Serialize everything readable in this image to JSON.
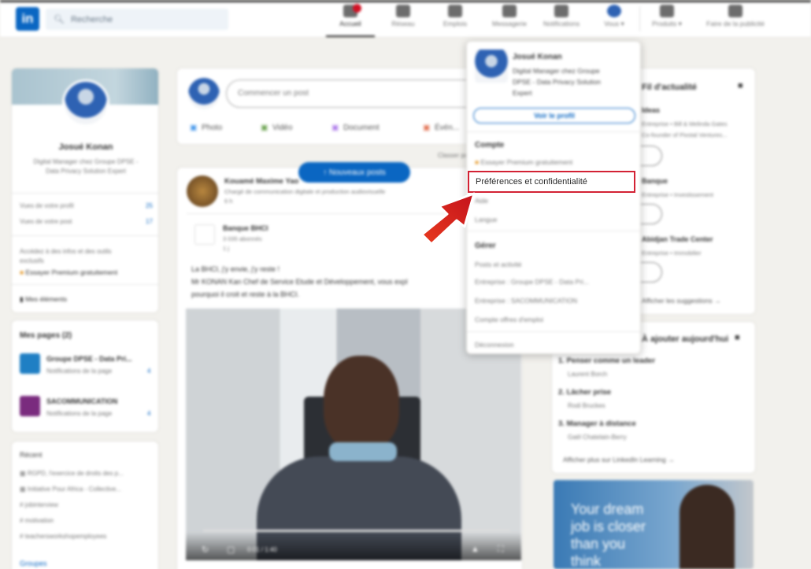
{
  "nav": {
    "logo": "in",
    "search_placeholder": "Recherche",
    "items": [
      {
        "label": "Accueil"
      },
      {
        "label": "Réseau"
      },
      {
        "label": "Emplois"
      },
      {
        "label": "Messagerie"
      },
      {
        "label": "Notifications"
      },
      {
        "label": "Vous ▾"
      },
      {
        "label": "Produits ▾"
      },
      {
        "label": "Faire de la publicité"
      }
    ]
  },
  "profile": {
    "name": "Josué Konan",
    "headline_1": "Digital Manager chez Groupe DPSE -",
    "headline_2": "Data Privacy Solution Expert",
    "stat_1": "Vues de votre profil",
    "stat_1_val": "25",
    "stat_2": "Vues de votre post",
    "stat_2_val": "17",
    "premium_1": "Accédez à des infos et des outils",
    "premium_2": "exclusifs",
    "premium_3": "Essayer Premium gratuitement",
    "saved": "Mes éléments"
  },
  "pages": {
    "title": "Mes pages (2)",
    "items": [
      {
        "name": "Groupe DPSE - Data Pri...",
        "sub": "Notifications de la page",
        "count": "4"
      },
      {
        "name": "SACOMMUNICATION",
        "sub": "Notifications de la page",
        "count": "4"
      }
    ]
  },
  "recent": {
    "title": "Récent",
    "items": [
      "RGPD, l'exercice de droits des p...",
      "Initiative Pour Africa - Collective...",
      "jobinterview",
      "motivation",
      "teachersworkshopemployees"
    ],
    "groups": "Groupes"
  },
  "composer": {
    "placeholder": "Commencer un post",
    "photo": "Photo",
    "video": "Vidéo",
    "document": "Document",
    "event": "Évén..."
  },
  "new_posts": "↑ Nouveaux posts",
  "sort_label": "Classer par",
  "post": {
    "author": "Kouamé Maxime Yao",
    "author_sub": "Chargé de communication digitale et production audiovisuelle",
    "time": "6 h",
    "shared_author": "Banque BHCI",
    "shared_sub": "3 035 abonnés",
    "shared_time": "1 j",
    "text_1": "La BHCI, j'y envie, j'y reste !",
    "text_2": "Mr KONAN Kan Chef de Service Etude et Développement, vous expl",
    "text_3": "pourquoi il croit et reste à la BHCI.",
    "video_time": "0:01 / 1:40"
  },
  "menu": {
    "name": "Josué Konan",
    "headline_1": "Digital Manager chez Groupe",
    "headline_2": "DPSE - Data Privacy Solution",
    "headline_3": "Expert",
    "view_profile": "Voir le profil",
    "account_title": "Compte",
    "premium": "Essayer Premium gratuitement",
    "preferences": "Préférences et confidentialité",
    "help": "Aide",
    "language": "Langue",
    "manage_title": "Gérer",
    "posts": "Posts et activité",
    "company_1": "Entreprise : Groupe DPSE - Data Pri...",
    "company_2": "Entreprise : SACOMMUNICATION",
    "jobs": "Compte offres d'emploi",
    "logout": "Déconnexion"
  },
  "news": {
    "title": "Fil d'actualité",
    "items": [
      {
        "name": "Ideas",
        "sub": "Entreprise • Bill & Melinda Gates",
        "sub2": "Co-founder of Pivotal Ventures..."
      },
      {
        "name": "Banque",
        "sub": "Entreprise • Investissement"
      },
      {
        "name": "Abidjan Trade Center",
        "sub": "Entreprise • Immobilier"
      }
    ],
    "more": "Afficher les suggestions →"
  },
  "learning": {
    "title": "À ajouter aujourd'hui",
    "items": [
      {
        "rank": "1.",
        "name": "Penser comme un leader",
        "author": "Laurent Borch"
      },
      {
        "rank": "2.",
        "name": "Lâcher prise",
        "author": "Rodi Bruckes"
      },
      {
        "rank": "3.",
        "name": "Manager à distance",
        "author": "Gaël Chatelain-Berry"
      }
    ],
    "more": "Afficher plus sur LinkedIn Learning →"
  },
  "promo": {
    "text": "Your dream job is closer than you think"
  }
}
